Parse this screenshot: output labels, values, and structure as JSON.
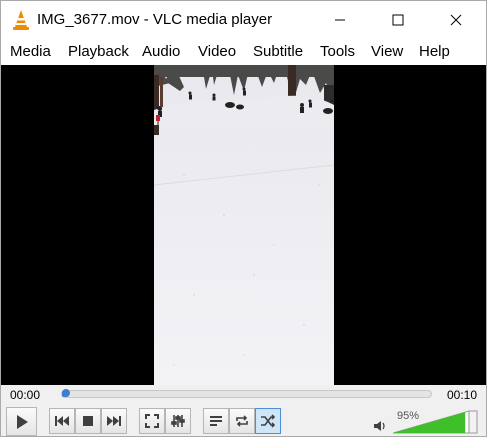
{
  "window": {
    "title": "IMG_3677.mov - VLC media player"
  },
  "menu": {
    "items": [
      {
        "label": "Media"
      },
      {
        "label": "Playback"
      },
      {
        "label": "Audio"
      },
      {
        "label": "Video"
      },
      {
        "label": "Subtitle"
      },
      {
        "label": "Tools"
      },
      {
        "label": "View"
      },
      {
        "label": "Help"
      }
    ]
  },
  "player": {
    "elapsed": "00:00",
    "total": "00:10",
    "progress": 0.01,
    "volume_label": "95%",
    "volume": 0.95,
    "shuffle_active": true
  },
  "icons": {
    "app": "vlc-cone-icon",
    "play": "play-icon",
    "previous": "previous-icon",
    "stop": "stop-icon",
    "next": "next-icon",
    "fullscreen": "fullscreen-icon",
    "extended": "extended-settings-icon",
    "playlist": "playlist-icon",
    "loop": "loop-icon",
    "shuffle": "shuffle-icon",
    "volume": "speaker-icon"
  },
  "colors": {
    "accent": "#3b7fd4",
    "volume_green": "#3fbf2a",
    "vlc_orange": "#f08a00"
  }
}
